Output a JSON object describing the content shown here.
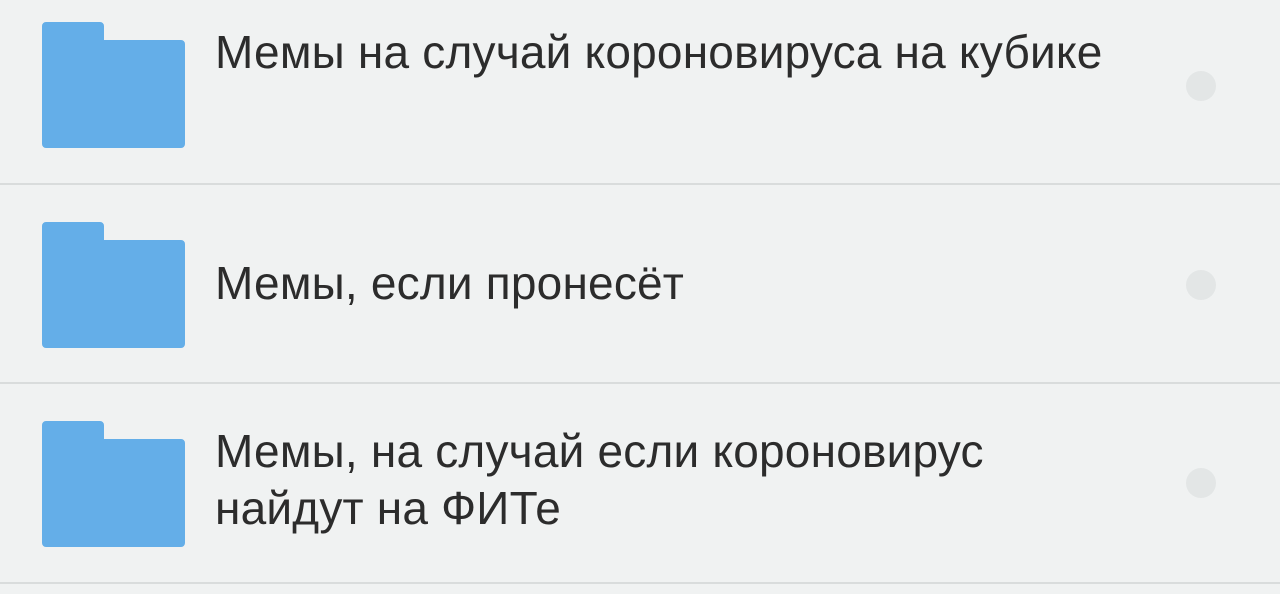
{
  "folders": [
    {
      "name": "Мемы на случай короновируса на кубике",
      "icon": "folder-icon",
      "selected": false
    },
    {
      "name": "Мемы, если пронесёт",
      "icon": "folder-icon",
      "selected": false
    },
    {
      "name": "Мемы, на случай если короновирус найдут на ФИТе",
      "icon": "folder-icon",
      "selected": false
    }
  ],
  "colors": {
    "background": "#f0f2f2",
    "folder": "#64aee8",
    "divider": "#d9dcdc",
    "text": "#2c2c2c",
    "select_dot": "#e3e6e6"
  }
}
